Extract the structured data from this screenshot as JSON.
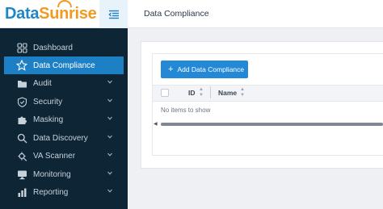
{
  "brand": {
    "part1": "Data",
    "part2": "Sunrise"
  },
  "header": {
    "title": "Data Compliance"
  },
  "sidebar": {
    "items": [
      {
        "label": "Dashboard",
        "icon": "grid-icon",
        "active": false,
        "expandable": false
      },
      {
        "label": "Data Compliance",
        "icon": "star-icon",
        "active": true,
        "expandable": false
      },
      {
        "label": "Audit",
        "icon": "folder-icon",
        "active": false,
        "expandable": true
      },
      {
        "label": "Security",
        "icon": "shield-icon",
        "active": false,
        "expandable": true
      },
      {
        "label": "Masking",
        "icon": "puzzle-icon",
        "active": false,
        "expandable": true
      },
      {
        "label": "Data Discovery",
        "icon": "magnifier-icon",
        "active": false,
        "expandable": true
      },
      {
        "label": "VA Scanner",
        "icon": "scanner-icon",
        "active": false,
        "expandable": true
      },
      {
        "label": "Monitoring",
        "icon": "monitor-icon",
        "active": false,
        "expandable": true
      },
      {
        "label": "Reporting",
        "icon": "chart-icon",
        "active": false,
        "expandable": true
      }
    ]
  },
  "main": {
    "add_button_label": "Add Data Compliance",
    "table": {
      "columns": [
        "ID",
        "Name"
      ],
      "empty_text": "No items to show"
    }
  },
  "colors": {
    "accent": "#1d7fc4",
    "button": "#2389d6",
    "sidebar_bg": "#0d2535",
    "logo_blue": "#1f86c9",
    "logo_orange": "#f29a1f"
  }
}
